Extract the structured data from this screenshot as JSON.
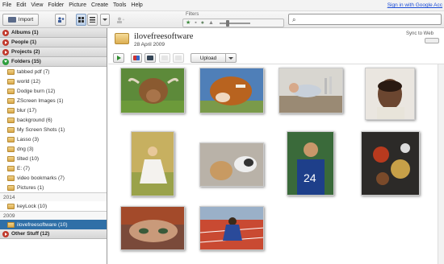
{
  "menu": [
    "File",
    "Edit",
    "View",
    "Folder",
    "Picture",
    "Create",
    "Tools",
    "Help"
  ],
  "signin_link": "Sign in with Google Acc",
  "toolbar": {
    "import_label": "Import",
    "filters_label": "Filters"
  },
  "sidebar": {
    "sections_top": [
      {
        "label": "Albums (1)",
        "state": "collapsed"
      },
      {
        "label": "People (1)",
        "state": "collapsed"
      },
      {
        "label": "Projects (2)",
        "state": "collapsed"
      },
      {
        "label": "Folders (15)",
        "state": "expanded"
      }
    ],
    "folders": [
      "tabbed pdf (7)",
      "world (12)",
      "Dodge burn (12)",
      "ZScreen Images (1)",
      "blur (17)",
      "background (6)",
      "My Screen Shots (1)",
      "Lasso (3)",
      "dng (3)",
      "tilted (10)",
      "E: (7)",
      "video bookmarks (7)",
      "Pictures (1)"
    ],
    "year_2014": "2014",
    "folders_2014": [
      "keyLock (10)"
    ],
    "year_2009": "2009",
    "selected_folder": "ilovefreesoftware (10)",
    "other_stuff": "Other Stuff (12)"
  },
  "album": {
    "title": "ilovefreesoftware",
    "date": "28 April 2009",
    "sync_label": "Sync to Web",
    "upload_label": "Upload"
  },
  "photos": [
    "highland-cow-photo",
    "brown-cow-photo",
    "sleeping-man-photo",
    "child-portrait-photo",
    "girl-in-field-photo",
    "dogs-photo",
    "football-fan-photo",
    "spices-photo",
    "woman-eyes-photo",
    "track-athlete-photo"
  ],
  "colors": {
    "selected_bg": "#2f6fa7",
    "link": "#1a4bd6",
    "collapsed_arrow": "#c0392b",
    "expanded_arrow": "#2e9e3c"
  }
}
